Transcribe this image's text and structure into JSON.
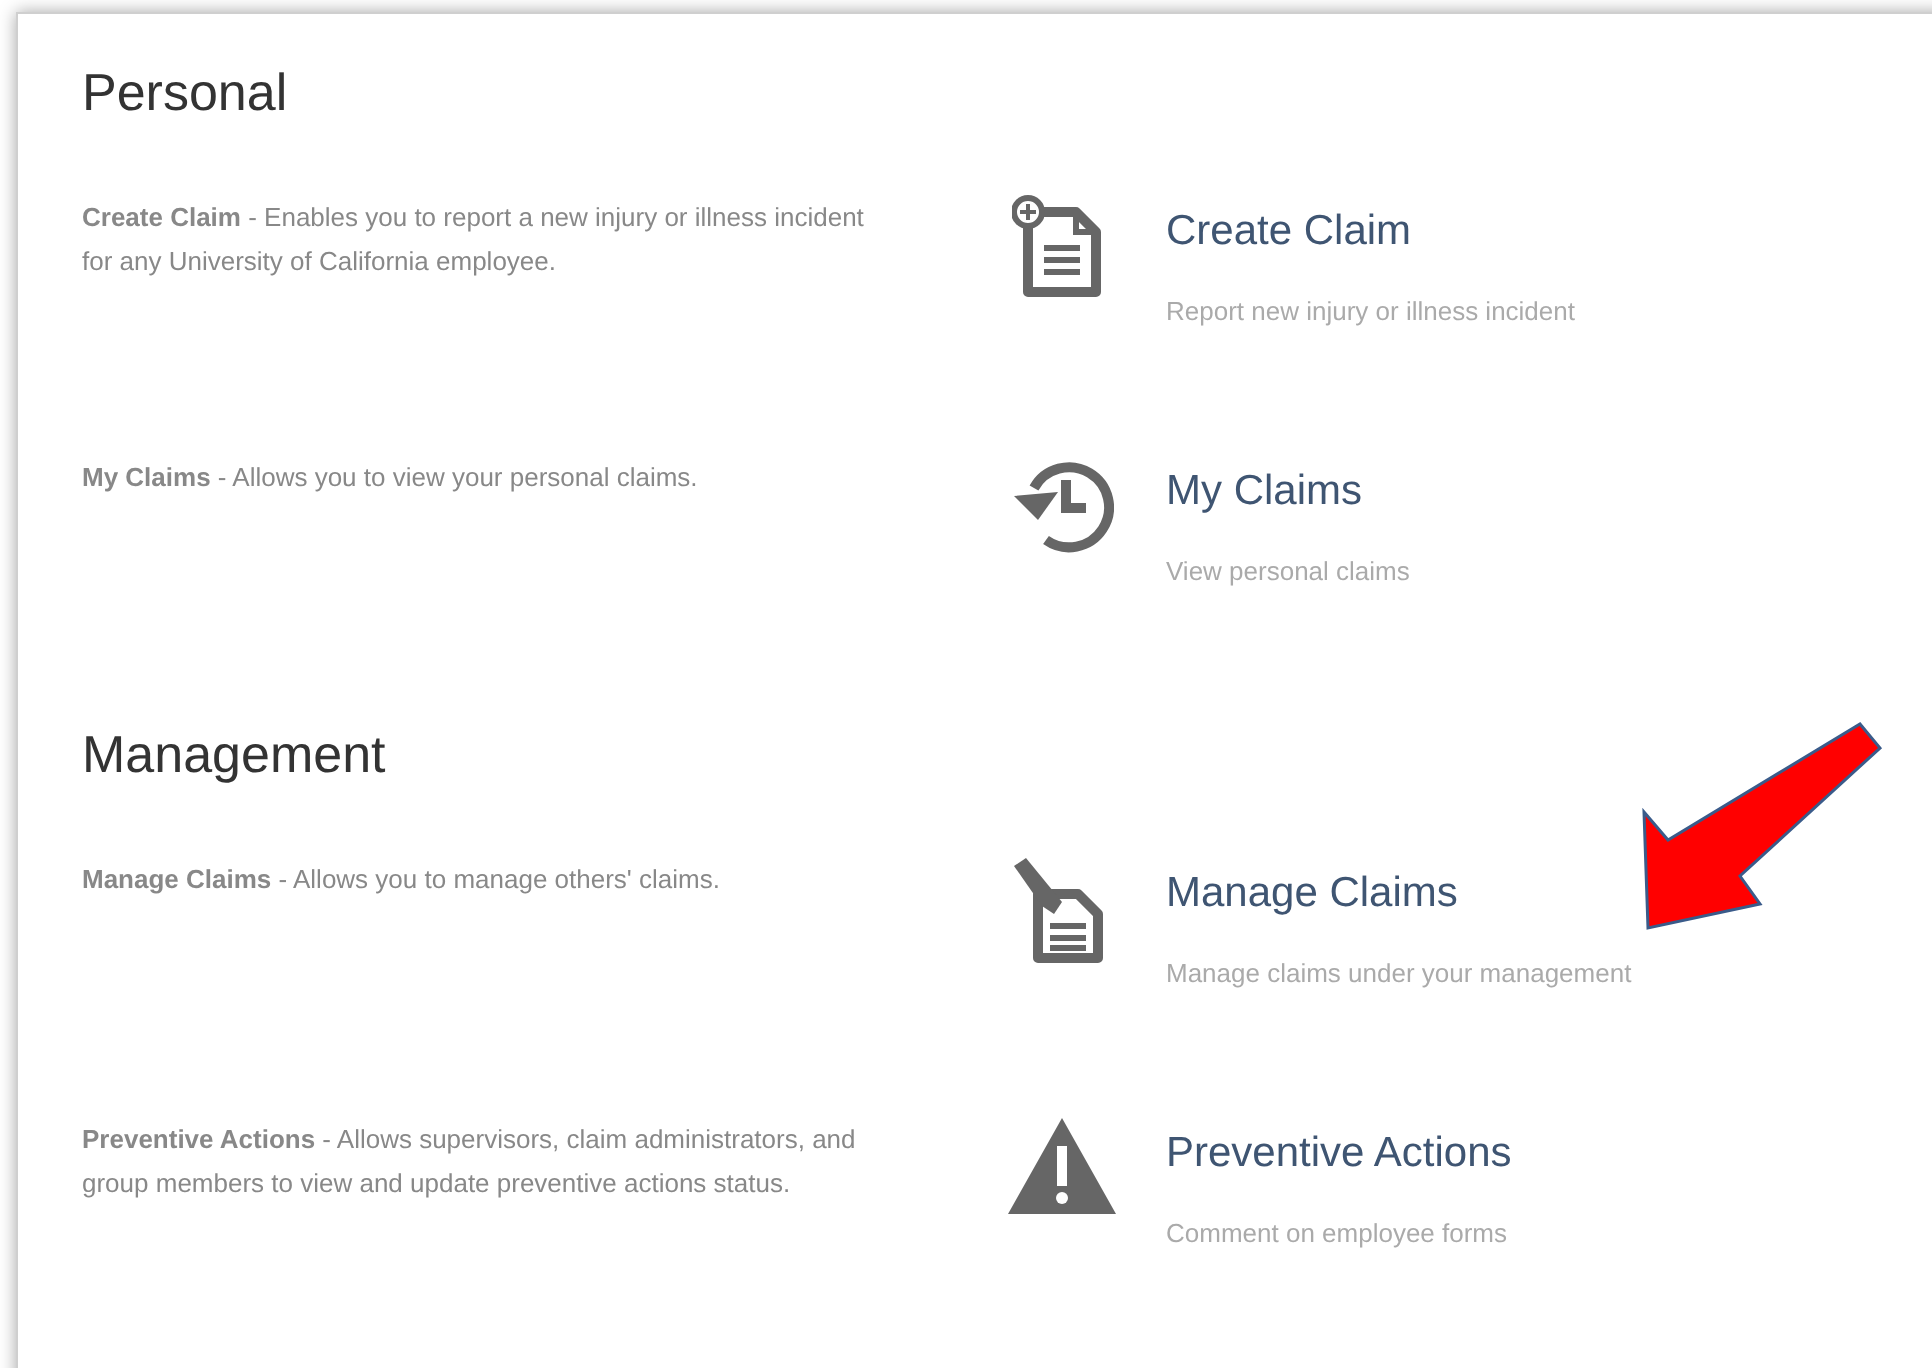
{
  "sections": [
    {
      "title": "Personal",
      "items": [
        {
          "description": "**Create Claim** - Enables you to report a new injury or illness incident for any University of California employee.",
          "title": "Create Claim",
          "subtitle": "Report new injury or illness incident"
        },
        {
          "description": "**My Claims** - Allows you to view your personal claims.",
          "title": "My Claims",
          "subtitle": "View personal claims"
        }
      ]
    },
    {
      "title": "Management",
      "items": [
        {
          "description": "**Manage Claims** - Allows you to manage others' claims.",
          "title": "Manage Claims",
          "subtitle": "Manage claims under your management"
        },
        {
          "description": "**Preventive Actions** - Allows supervisors, claim administrators, and group members to view and update preventive actions status.",
          "title": "Preventive Actions",
          "subtitle": "Comment on employee forms"
        }
      ]
    }
  ]
}
